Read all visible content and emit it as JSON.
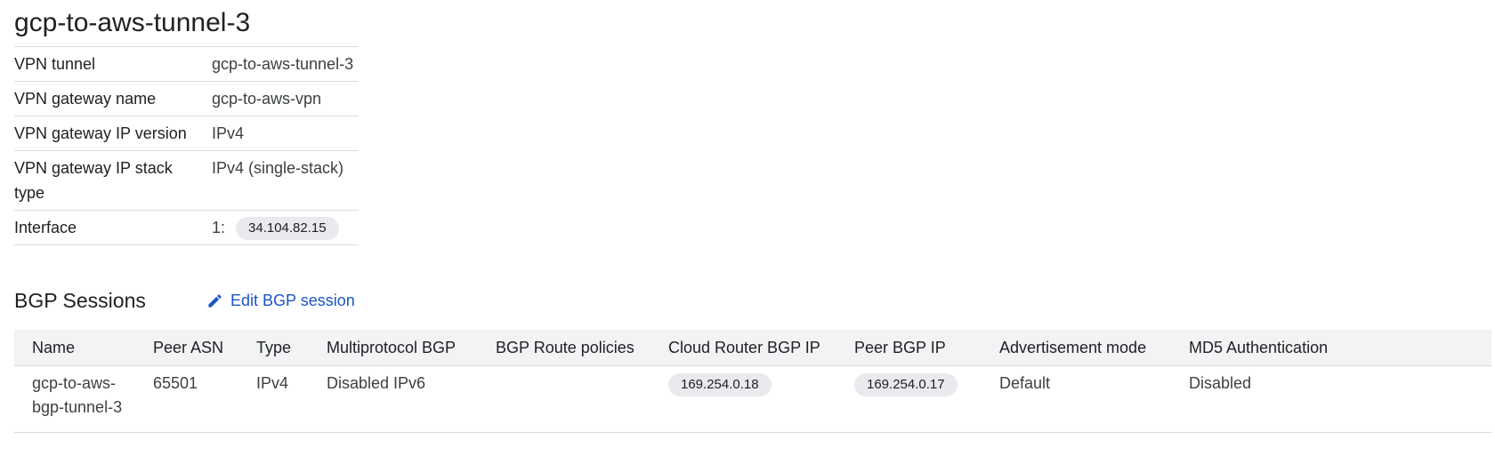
{
  "page": {
    "title": "gcp-to-aws-tunnel-3"
  },
  "details": {
    "rows": [
      {
        "label": "VPN tunnel",
        "value": "gcp-to-aws-tunnel-3"
      },
      {
        "label": "VPN gateway name",
        "value": "gcp-to-aws-vpn"
      },
      {
        "label": "VPN gateway IP version",
        "value": "IPv4"
      },
      {
        "label": "VPN gateway IP stack type",
        "value": "IPv4 (single-stack)"
      },
      {
        "label": "Interface",
        "index": "1:",
        "value": "34.104.82.15"
      }
    ]
  },
  "bgp": {
    "section_title": "BGP Sessions",
    "edit_label": "Edit BGP session",
    "edit_icon": "pencil-icon",
    "columns": [
      "Name",
      "Peer ASN",
      "Type",
      "Multiprotocol BGP",
      "BGP Route policies",
      "Cloud Router BGP IP",
      "Peer BGP IP",
      "Advertisement mode",
      "MD5 Authentication"
    ],
    "rows": [
      {
        "name": "gcp-to-aws-bgp-tunnel-3",
        "peer_asn": "65501",
        "type": "IPv4",
        "multiprotocol_bgp": "Disabled IPv6",
        "route_policies": "",
        "cloud_router_bgp_ip": "169.254.0.18",
        "peer_bgp_ip": "169.254.0.17",
        "advertisement_mode": "Default",
        "md5_authentication": "Disabled"
      }
    ]
  },
  "colors": {
    "link": "#1a56c5",
    "header_bg": "#f1f3f4",
    "chip_bg": "#e8eaed",
    "divider": "#dadce0"
  }
}
